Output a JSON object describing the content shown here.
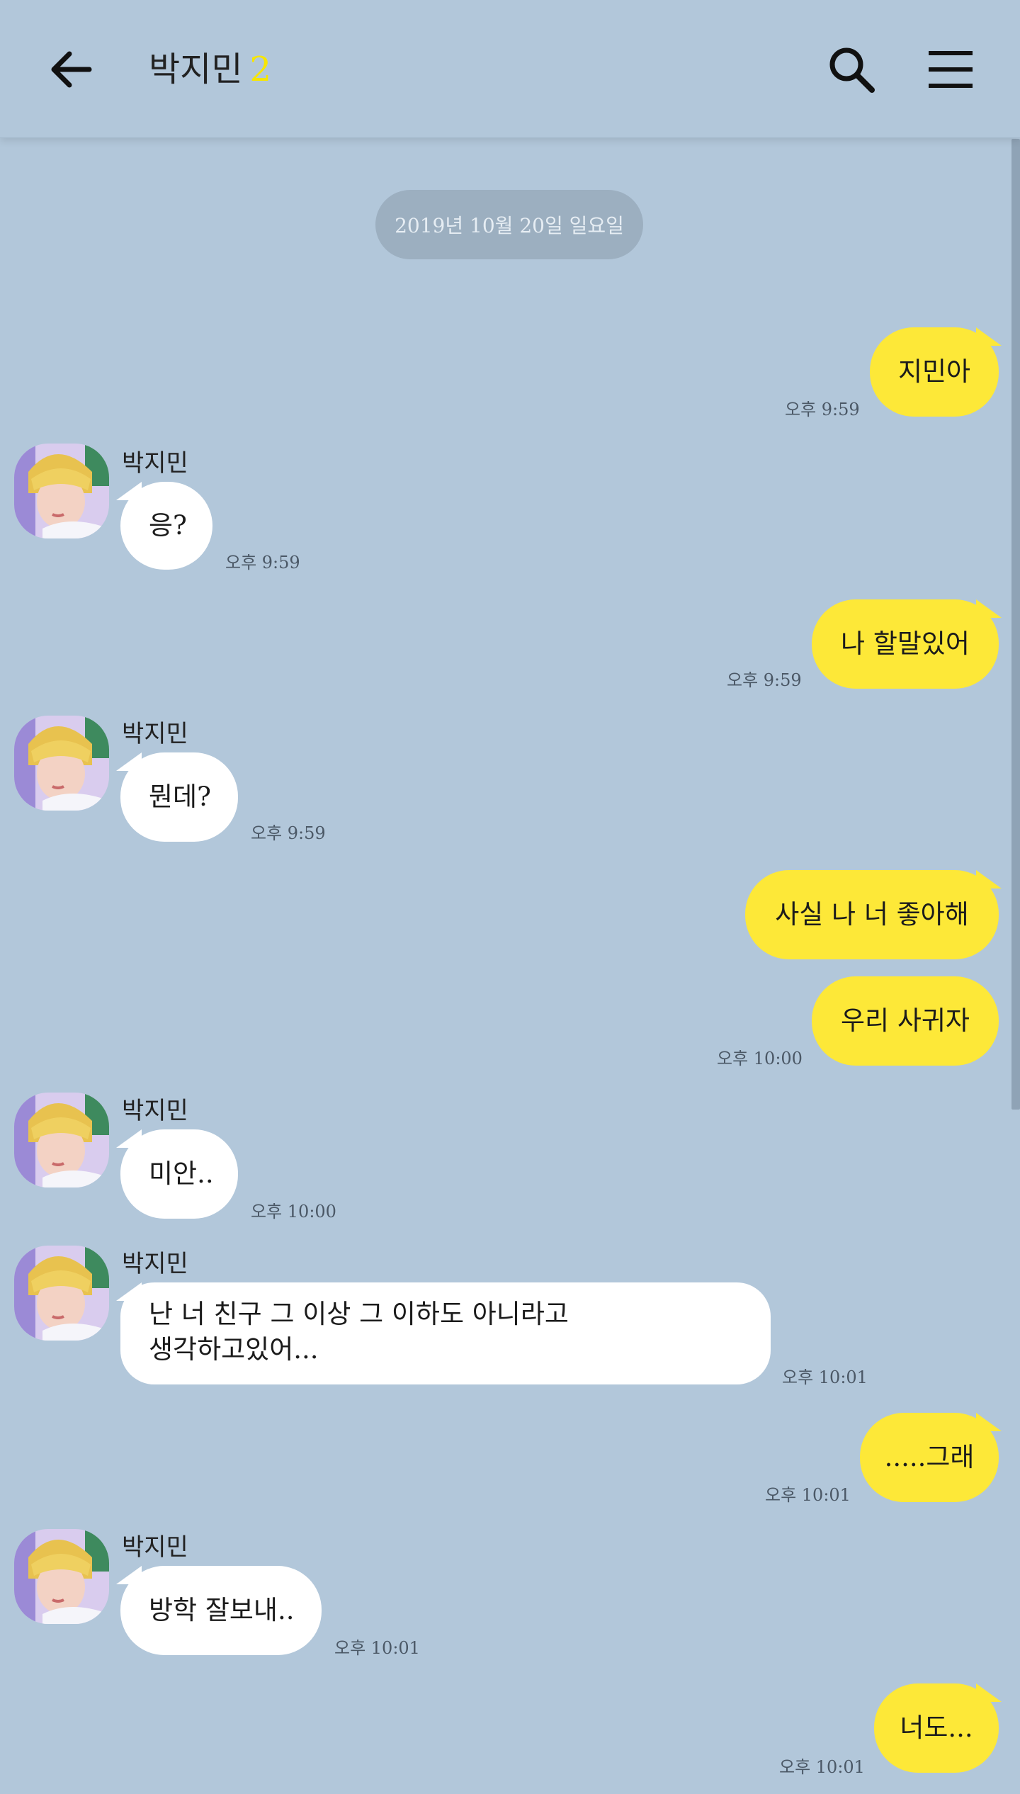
{
  "header": {
    "back_icon": "arrow-left-icon",
    "title": "박지민",
    "member_count": "2",
    "search_icon": "search-icon",
    "menu_icon": "menu-icon"
  },
  "colors": {
    "background": "#b2c7da",
    "sent_bubble": "#fde838",
    "received_bubble": "#ffffff",
    "count_accent": "#f7e600"
  },
  "date_divider": "2019년 10월 20일 일요일",
  "messages": [
    {
      "side": "sent",
      "text": "지민아",
      "time": "오후 9:59"
    },
    {
      "side": "received",
      "sender": "박지민",
      "text": "응?",
      "time": "오후 9:59"
    },
    {
      "side": "sent",
      "text": "나 할말있어",
      "time": "오후 9:59"
    },
    {
      "side": "received",
      "sender": "박지민",
      "text": "뭔데?",
      "time": "오후 9:59"
    },
    {
      "side": "sent",
      "text": "사실 나 너 좋아해",
      "time": ""
    },
    {
      "side": "sent",
      "text": "우리 사귀자",
      "time": "오후 10:00"
    },
    {
      "side": "received",
      "sender": "박지민",
      "text": "미안..",
      "time": "오후 10:00"
    },
    {
      "side": "received",
      "sender": "박지민",
      "text_lines": [
        "난 너 친구 그 이상 그 이하도 아니라고",
        "생각하고있어..."
      ],
      "time": "오후 10:01"
    },
    {
      "side": "sent",
      "text": ".....그래",
      "time": "오후 10:01"
    },
    {
      "side": "received",
      "sender": "박지민",
      "text": "방학 잘보내..",
      "time": "오후 10:01"
    },
    {
      "side": "sent",
      "text": "너도...",
      "time": "오후 10:01"
    }
  ]
}
